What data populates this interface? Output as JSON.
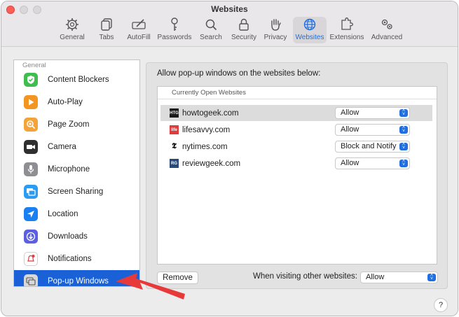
{
  "window": {
    "title": "Websites"
  },
  "toolbar": {
    "tabs": [
      {
        "label": "General",
        "icon": "gear-icon"
      },
      {
        "label": "Tabs",
        "icon": "tabs-icon"
      },
      {
        "label": "AutoFill",
        "icon": "pencil-icon"
      },
      {
        "label": "Passwords",
        "icon": "key-icon"
      },
      {
        "label": "Search",
        "icon": "search-icon"
      },
      {
        "label": "Security",
        "icon": "lock-icon"
      },
      {
        "label": "Privacy",
        "icon": "hand-icon"
      },
      {
        "label": "Websites",
        "icon": "globe-icon",
        "active": true
      },
      {
        "label": "Extensions",
        "icon": "puzzle-icon"
      },
      {
        "label": "Advanced",
        "icon": "gears-icon"
      }
    ]
  },
  "sidebar": {
    "header": "General",
    "items": [
      {
        "label": "Content Blockers",
        "icon": "checkmark-shield-icon",
        "color": "#3fbd4f"
      },
      {
        "label": "Auto-Play",
        "icon": "play-icon",
        "color": "#f39521"
      },
      {
        "label": "Page Zoom",
        "icon": "magnifier-plus-icon",
        "color": "#f2a33a"
      },
      {
        "label": "Camera",
        "icon": "video-camera-icon",
        "color": "#2f2f2f"
      },
      {
        "label": "Microphone",
        "icon": "microphone-icon",
        "color": "#8e8e93"
      },
      {
        "label": "Screen Sharing",
        "icon": "screen-share-icon",
        "color": "#2b9cf2"
      },
      {
        "label": "Location",
        "icon": "location-arrow-icon",
        "color": "#1a7ff0"
      },
      {
        "label": "Downloads",
        "icon": "download-icon",
        "color": "#5b5fe0"
      },
      {
        "label": "Notifications",
        "icon": "bell-icon",
        "color": "#ffffff"
      },
      {
        "label": "Pop-up Windows",
        "icon": "popup-window-icon",
        "color": "#d8d8d8",
        "selected": true
      }
    ]
  },
  "panel": {
    "heading": "Allow pop-up windows on the websites below:",
    "table_header": "Currently Open Websites",
    "sites": [
      {
        "domain": "howtogeek.com",
        "setting": "Allow",
        "favicon_text": "HTG",
        "favicon_color": "#1a1a1a"
      },
      {
        "domain": "lifesavvy.com",
        "setting": "Allow",
        "favicon_text": "life",
        "favicon_color": "#e23b3b"
      },
      {
        "domain": "nytimes.com",
        "setting": "Block and Notify",
        "favicon_text": "𝕿",
        "favicon_color": "#ffffff"
      },
      {
        "domain": "reviewgeek.com",
        "setting": "Allow",
        "favicon_text": "RG",
        "favicon_color": "#274a7a"
      }
    ],
    "remove_label": "Remove",
    "other_label": "When visiting other websites:",
    "other_value": "Allow"
  },
  "help_label": "?",
  "accent": "#1a60d6",
  "annotation_arrow_color": "#e8393a"
}
